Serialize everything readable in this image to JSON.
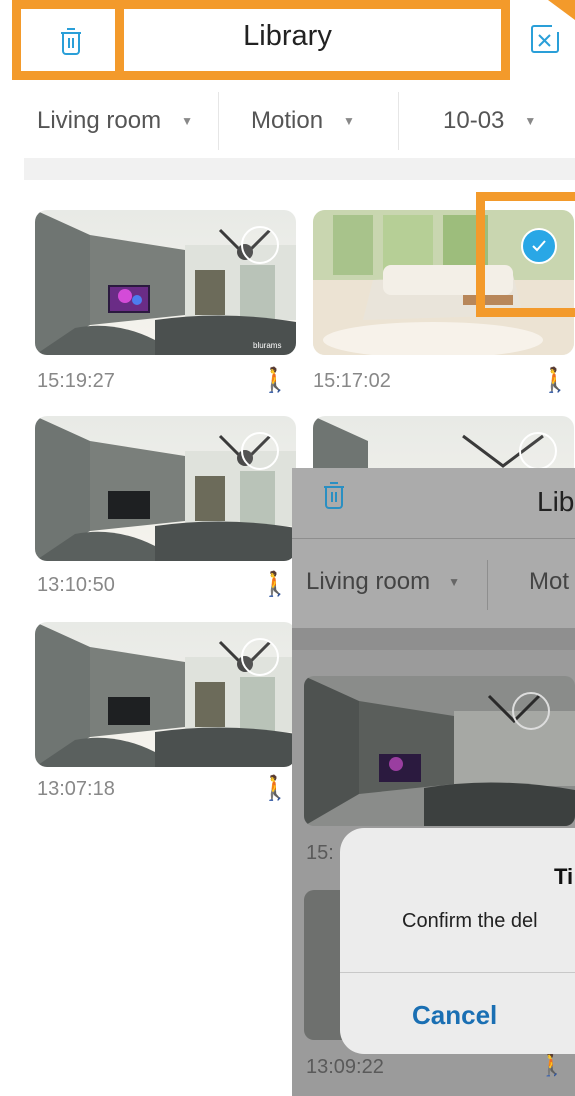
{
  "header": {
    "title": "Library"
  },
  "filters": {
    "room": "Living room",
    "event": "Motion",
    "date": "10-03"
  },
  "clips": [
    {
      "time": "15:19:27",
      "selected": false
    },
    {
      "time": "15:17:02",
      "selected": true
    },
    {
      "time": "13:10:50",
      "selected": false
    },
    {
      "time": "13:07:18",
      "selected": false
    }
  ],
  "watermark": "blurams",
  "overlay": {
    "title": "Lib",
    "room": "Living room",
    "event": "Mot",
    "time_partial": "15:",
    "time2": "13:09:22"
  },
  "dialog": {
    "title": "Ti",
    "message": "Confirm the del",
    "cancel": "Cancel"
  },
  "colors": {
    "accent": "#f39a2b",
    "select": "#29a7e6",
    "motion": "#f0a11c"
  }
}
